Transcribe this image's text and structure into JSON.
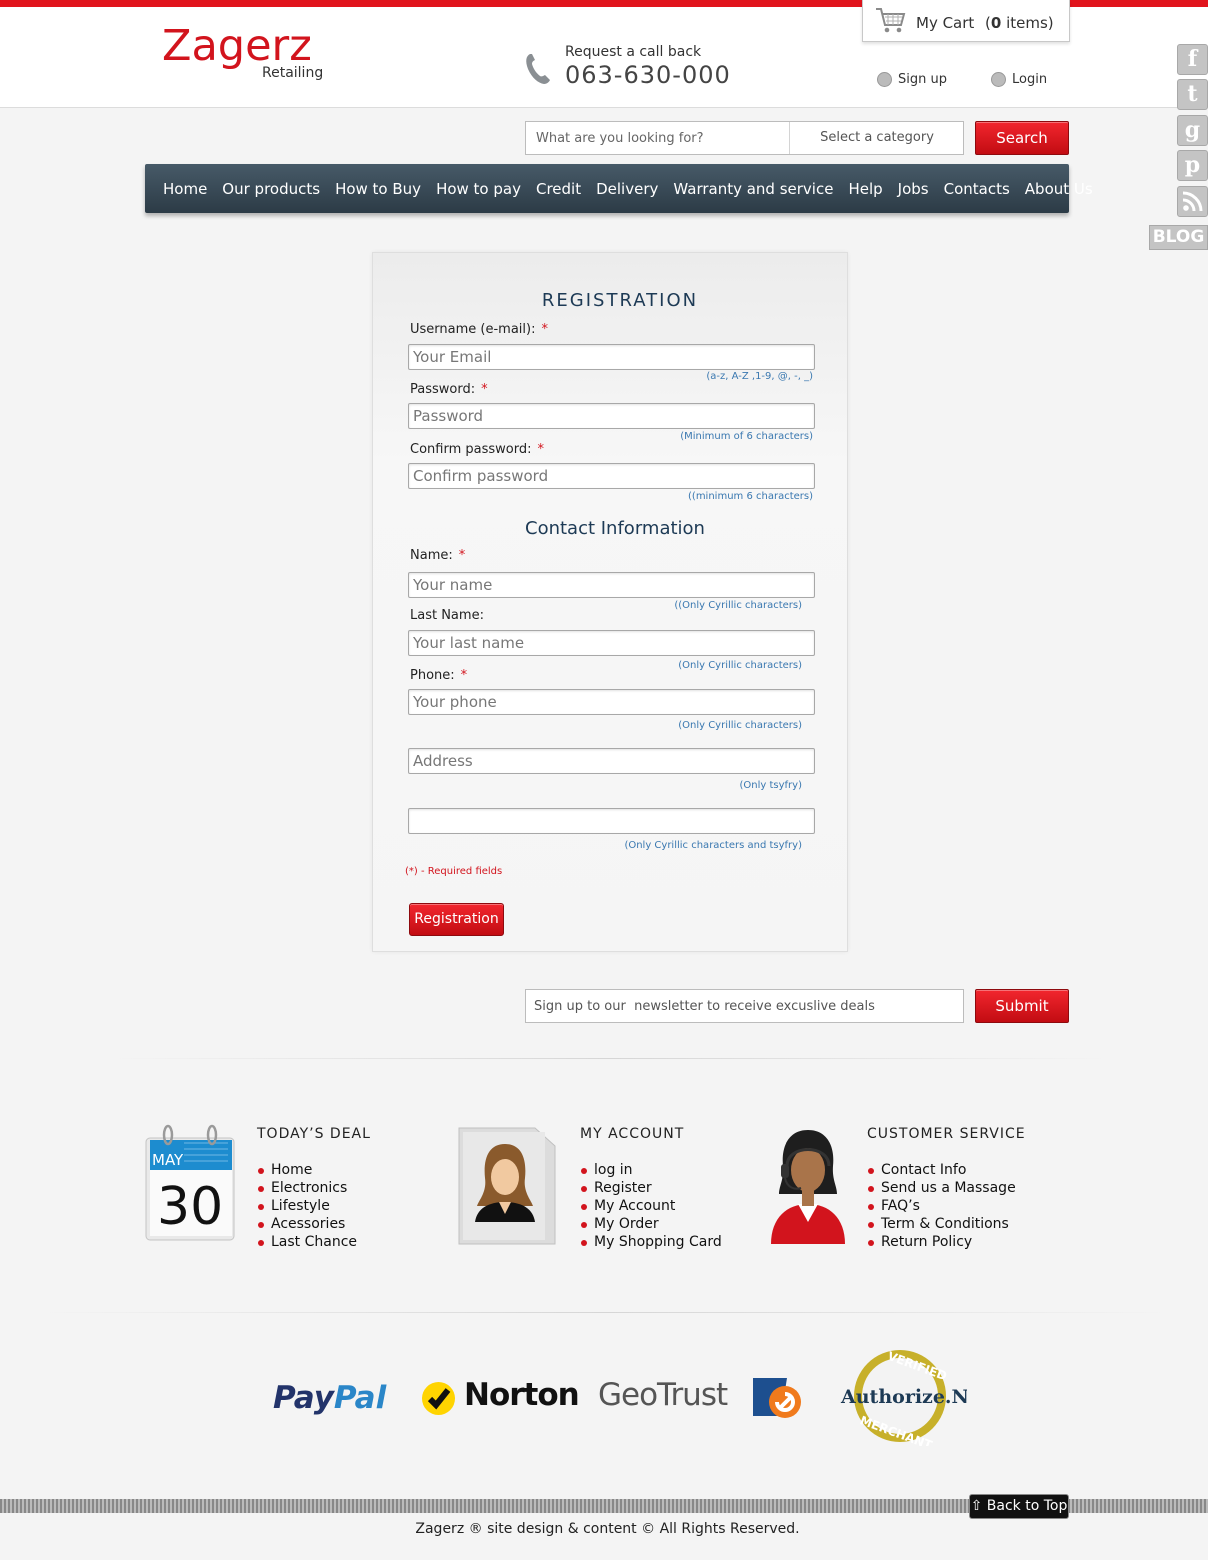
{
  "header": {
    "logo": "Zagerz",
    "logo_sub": "Retailing",
    "callback_label": "Request a call back",
    "phone": "063-630-000",
    "cart_label": "My Cart",
    "cart_count_open": "(",
    "cart_count_number": "0",
    "cart_count_rest": " items)",
    "signup_label": "Sign up",
    "login_label": "Login"
  },
  "social": {
    "facebook": "f",
    "twitter": "t",
    "google": "g",
    "pinterest": "p",
    "rss": "",
    "blog": "BLOG"
  },
  "search": {
    "placeholder": "What are you looking for?",
    "category_label": "Select a category",
    "button": "Search"
  },
  "nav": {
    "items": [
      "Home",
      "Our products",
      "How to Buy",
      "How to pay",
      "Credit",
      "Delivery",
      "Warranty and service",
      "Help",
      "Jobs",
      "Contacts",
      "About Us"
    ]
  },
  "registration": {
    "title": "REGISTRATION",
    "username_label": "Username (e-mail):",
    "username_placeholder": "Your Email",
    "username_hint": "(a-z, A-Z ,1-9, @, -, _)",
    "password_label": "Password:",
    "password_placeholder": "Password",
    "password_hint": "(Minimum of 6 characters)",
    "confirm_label": "Confirm password:",
    "confirm_placeholder": "Confirm password",
    "confirm_hint": "((minimum 6 characters)",
    "contact_title": "Contact Information",
    "name_label": "Name:",
    "name_placeholder": "Your name",
    "name_hint": "((Only Cyrillic characters)",
    "lastname_label": "Last Name:",
    "lastname_placeholder": "Your last name",
    "lastname_hint": "(Only Cyrillic characters)",
    "phone_label": "Phone:",
    "phone_placeholder": "Your phone",
    "phone_hint": "(Only Cyrillic characters)",
    "address_placeholder": "Address",
    "address_hint": "(Only tsyfry)",
    "extra_placeholder": "",
    "extra_hint": "(Only Cyrillic characters and tsyfry)",
    "required_star": "*",
    "required_note": "(*) - Required fields",
    "submit": "Registration"
  },
  "newsletter": {
    "placeholder": "Sign up to our  newsletter to receive excuslive deals",
    "button": "Submit"
  },
  "footer": {
    "deal": {
      "title": "TODAY’S DEAL",
      "month": "MAY",
      "day": "30",
      "items": [
        "Home",
        "Electronics",
        "Lifestyle",
        "Acessories",
        "Last Chance"
      ]
    },
    "account": {
      "title": "MY ACCOUNT",
      "items": [
        "log in",
        "Register",
        "My Account",
        "My Order",
        "My Shopping Card"
      ]
    },
    "service": {
      "title": "CUSTOMER SERVICE",
      "items": [
        "Contact Info",
        "Send us a Massage",
        "FAQ’s",
        "Term & Conditions",
        "Return Policy"
      ]
    }
  },
  "partners": {
    "paypal_a": "Pay",
    "paypal_b": "Pal",
    "norton": "Norton",
    "geotrust": "GeoTrust",
    "authnet": "Authorize.Net",
    "authnet_top": "VERIFIED",
    "authnet_bottom": "MERCHANT"
  },
  "bottom": {
    "back_to_top": "Back to Top",
    "copyright": "Zagerz ® site design & content © All Rights Reserved."
  },
  "colors": {
    "brand_red": "#d2141d",
    "nav_dark": "#2c3b46",
    "hint_blue": "#3a78b0"
  }
}
